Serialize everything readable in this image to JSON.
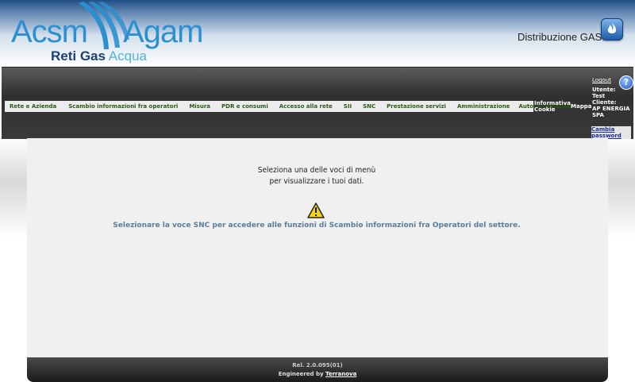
{
  "header": {
    "logo_acsm": "Acsm",
    "logo_agam": "Agam",
    "logo_reti_gas": "Reti Gas",
    "logo_acqua": "Acqua",
    "service_name": "Distribuzione GAS",
    "flame_icon": "flame-icon"
  },
  "nav": {
    "menu": [
      "Rete e Azienda",
      "Scambio informazioni fra operatori",
      "Misura",
      "PDR e consumi",
      "Accesso alla rete",
      "SII",
      "SNC",
      "Prestazione servizi",
      "Amministrazione",
      "Autocertificazioni"
    ],
    "informativa_cookie": "Informativa Cookie",
    "mappa": "Mappa",
    "logout": "Logout",
    "help": "?",
    "user_label": "Utente:",
    "user_value": "Test",
    "client_label": "Cliente:",
    "client_value": "AP ENERGIA SPA",
    "change_password": "Cambia password"
  },
  "content": {
    "instruction_line1": "Seleziona una delle voci di menù",
    "instruction_line2": "per visualizzare i tuoi dati.",
    "snc_message": "Selezionare la voce SNC per accedere alle funzioni di Scambio informazioni fra Operatori del settore."
  },
  "footer": {
    "release": "Rel. 2.0.095(01)",
    "engineered_by": "Engineered by",
    "vendor_link": "Terranova"
  },
  "colors": {
    "brand_blue": "#2b8fd0",
    "menu_text": "#2a5a14",
    "nav_bg": "#3a3a3a",
    "message_blue": "#5b7c9c"
  }
}
